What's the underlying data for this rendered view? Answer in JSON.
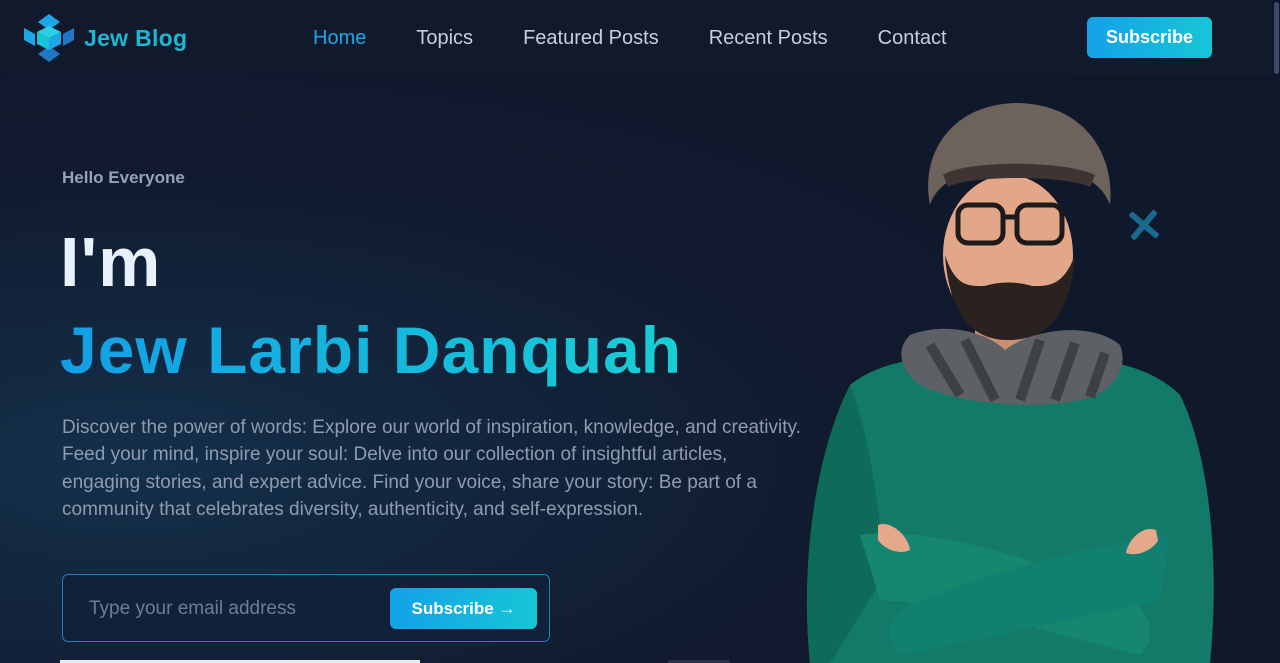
{
  "header": {
    "brand": "Jew Blog",
    "nav": [
      {
        "label": "Home",
        "active": true
      },
      {
        "label": "Topics",
        "active": false
      },
      {
        "label": "Featured Posts",
        "active": false
      },
      {
        "label": "Recent Posts",
        "active": false
      },
      {
        "label": "Contact",
        "active": false
      }
    ],
    "subscribe_label": "Subscribe"
  },
  "hero": {
    "greeting": "Hello Everyone",
    "intro": "I'm",
    "name": "Jew Larbi Danquah",
    "description": "Discover the power of words: Explore our world of inspiration, knowledge, and creativity. Feed your mind, inspire your soul: Delve into our collection of insightful articles, engaging stories, and expert advice. Find your voice, share your story: Be part of a community that celebrates diversity, authenticity, and self-expression.",
    "email_placeholder": "Type your email address",
    "form_button": "Subscribe →"
  },
  "colors": {
    "background": "#0f1629",
    "accent": "#1ea7e8",
    "accent_end": "#16c6d6",
    "text_muted": "#8e9bb0"
  },
  "icons": [
    "logo-icon",
    "plus-decoration-icon"
  ]
}
